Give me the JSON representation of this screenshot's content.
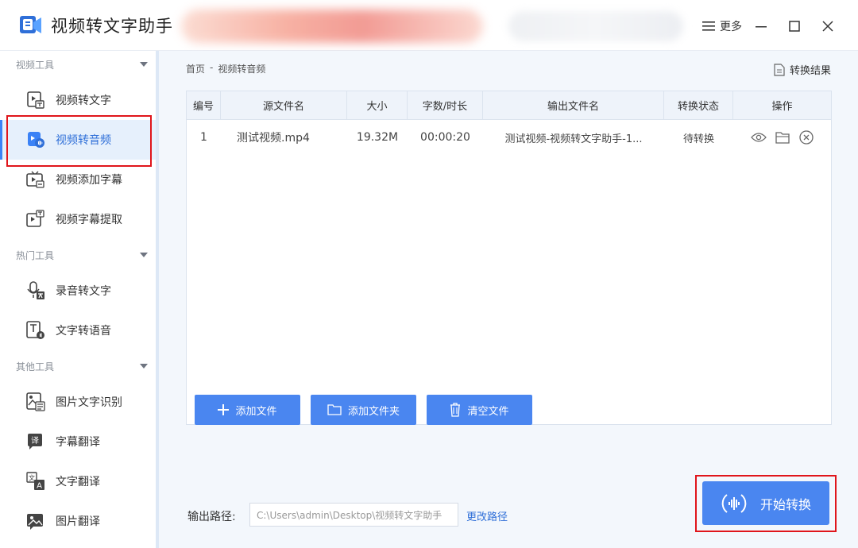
{
  "app": {
    "title": "视频转文字助手"
  },
  "window": {
    "more_label": "更多"
  },
  "sidebar": {
    "groups": [
      {
        "label": "视频工具",
        "items": [
          {
            "label": "视频转文字",
            "icon": "video-text-icon"
          },
          {
            "label": "视频转音频",
            "icon": "video-audio-icon",
            "active": true
          },
          {
            "label": "视频添加字幕",
            "icon": "video-subtitle-icon"
          },
          {
            "label": "视频字幕提取",
            "icon": "subtitle-extract-icon"
          }
        ]
      },
      {
        "label": "热门工具",
        "items": [
          {
            "label": "录音转文字",
            "icon": "mic-text-icon"
          },
          {
            "label": "文字转语音",
            "icon": "text-speech-icon"
          }
        ]
      },
      {
        "label": "其他工具",
        "items": [
          {
            "label": "图片文字识别",
            "icon": "image-ocr-icon"
          },
          {
            "label": "字幕翻译",
            "icon": "subtitle-translate-icon"
          },
          {
            "label": "文字翻译",
            "icon": "text-translate-icon"
          },
          {
            "label": "图片翻译",
            "icon": "image-translate-icon"
          }
        ]
      }
    ]
  },
  "breadcrumb": {
    "home": "首页",
    "sep": "-",
    "current": "视频转音频"
  },
  "result_link": "转换结果",
  "table": {
    "columns": [
      "编号",
      "源文件名",
      "大小",
      "字数/时长",
      "输出文件名",
      "转换状态",
      "操作"
    ],
    "rows": [
      {
        "index": "1",
        "source": "测试视频.mp4",
        "size": "19.32M",
        "duration": "00:00:20",
        "output": "测试视频-视频转文字助手-1...",
        "status": "待转换"
      }
    ]
  },
  "buttons": {
    "add_file": "添加文件",
    "add_folder": "添加文件夹",
    "clear_files": "清空文件",
    "start": "开始转换"
  },
  "output": {
    "label": "输出路径:",
    "path": "C:\\Users\\admin\\Desktop\\视频转文字助手",
    "change": "更改路径"
  },
  "colors": {
    "accent": "#4a86f0",
    "highlight": "#e0151b",
    "active_bg": "#e6f0fc"
  }
}
